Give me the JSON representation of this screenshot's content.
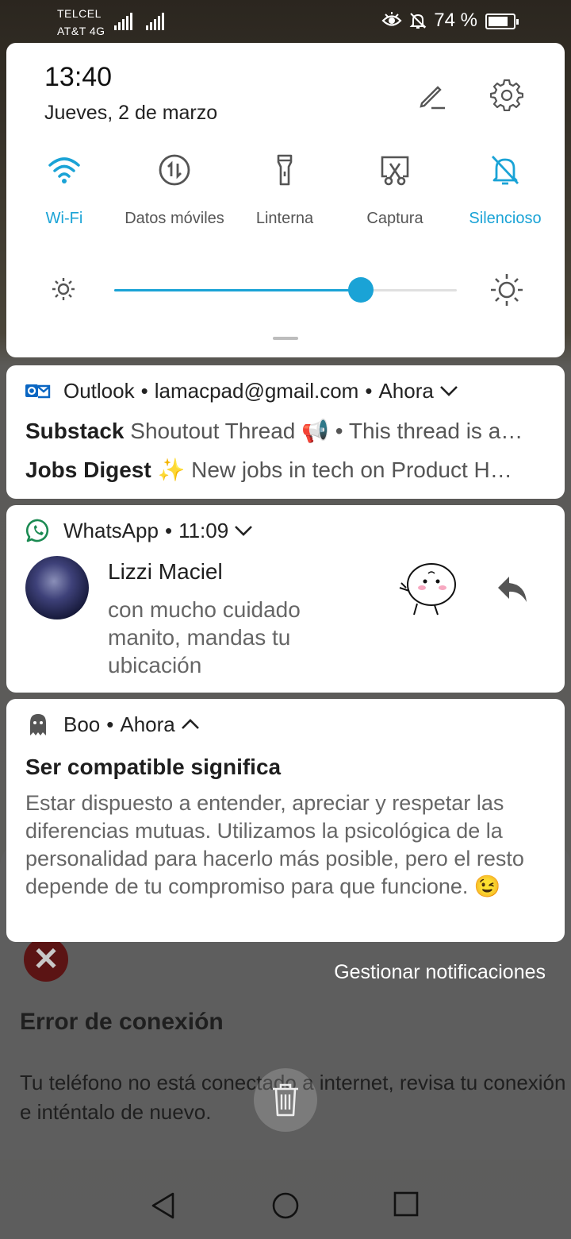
{
  "status_bar": {
    "carrier_primary": "TELCEL",
    "carrier_secondary": "AT&T 4G",
    "battery_text": "74 %",
    "battery_level": 0.74
  },
  "quick_settings": {
    "time": "13:40",
    "date": "Jueves, 2 de marzo",
    "tiles": [
      {
        "label": "Wi-Fi",
        "icon": "wifi-icon",
        "active": true
      },
      {
        "label": "Datos móviles",
        "icon": "mobile-data-icon",
        "active": false
      },
      {
        "label": "Linterna",
        "icon": "flashlight-icon",
        "active": false
      },
      {
        "label": "Captura",
        "icon": "screenshot-icon",
        "active": false
      },
      {
        "label": "Silencioso",
        "icon": "silent-icon",
        "active": true
      }
    ],
    "brightness_level": 0.72,
    "accent_color": "#1aa3d6"
  },
  "outlook": {
    "app": "Outlook",
    "account": "lamacpad@gmail.com",
    "time": "Ahora",
    "rows": [
      {
        "sender": "Substack",
        "text": "Shoutout Thread 📢 • This thread is a…"
      },
      {
        "sender": "Jobs Digest",
        "text": "✨ New jobs in tech on Product H…"
      }
    ]
  },
  "whatsapp": {
    "app": "WhatsApp",
    "time": "11:09",
    "contact": "Lizzi Maciel",
    "message": "con mucho cuidado manito, mandas tu ubicación"
  },
  "boo": {
    "app": "Boo",
    "time": "Ahora",
    "title": "Ser compatible significa",
    "body": "Estar dispuesto a entender, apreciar y respetar las diferencias mutuas. Utilizamos la psicológica de la personalidad para hacerlo más posible, pero el resto depende de tu compromiso para que funcione. 😉"
  },
  "manage_label": "Gestionar notificaciones",
  "background_app": {
    "error_title": "Error de conexión",
    "error_text": "Tu teléfono no está conectado a internet, revisa tu conexión e inténtalo de nuevo."
  },
  "separator": "•"
}
